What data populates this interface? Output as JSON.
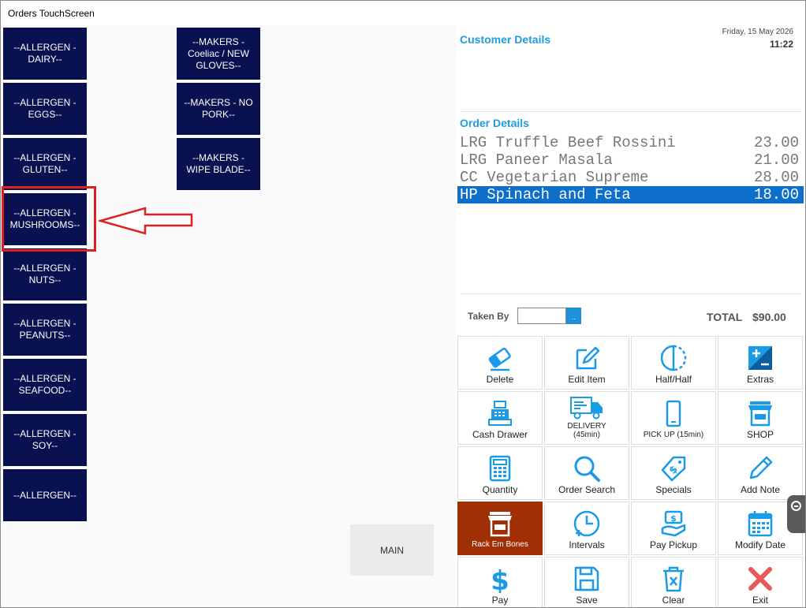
{
  "window": {
    "title": "Orders TouchScreen"
  },
  "categories": {
    "col1": [
      "--ALLERGEN - DAIRY--",
      "--ALLERGEN - EGGS--",
      "--ALLERGEN - GLUTEN--",
      "--ALLERGEN - MUSHROOMS--",
      "--ALLERGEN - NUTS--",
      "--ALLERGEN - PEANUTS--",
      "--ALLERGEN - SEAFOOD--",
      "--ALLERGEN - SOY--",
      "--ALLERGEN--"
    ],
    "col2": [
      "--MAKERS - Coeliac / NEW GLOVES--",
      "--MAKERS - NO PORK--",
      "--MAKERS - WIPE BLADE--"
    ],
    "main_label": "MAIN"
  },
  "header": {
    "date": "Friday, 15 May 2026",
    "time": "11:22"
  },
  "customer": {
    "heading": "Customer Details"
  },
  "order": {
    "heading": "Order Details",
    "items": [
      {
        "name": "LRG Truffle Beef Rossini",
        "price": "23.00",
        "selected": false
      },
      {
        "name": "LRG Paneer Masala",
        "price": "21.00",
        "selected": false
      },
      {
        "name": "CC Vegetarian Supreme",
        "price": "28.00",
        "selected": false
      },
      {
        "name": "HP Spinach and Feta",
        "price": "18.00",
        "selected": true
      }
    ],
    "taken_by_label": "Taken By",
    "taken_by_button": "..",
    "total_label": "TOTAL",
    "total_value": "$90.00"
  },
  "actions": [
    {
      "label": "Delete",
      "icon": "eraser-icon"
    },
    {
      "label": "Edit Item",
      "icon": "edit-icon"
    },
    {
      "label": "Half/Half",
      "icon": "half-circle-icon"
    },
    {
      "label": "Extras",
      "icon": "plus-minus-icon"
    },
    {
      "label": "Cash Drawer",
      "icon": "cash-register-icon"
    },
    {
      "label": "DELIVERY (45min)",
      "icon": "truck-icon"
    },
    {
      "label": "PICK UP (15min)",
      "icon": "phone-icon"
    },
    {
      "label": "SHOP",
      "icon": "shop-icon"
    },
    {
      "label": "Quantity",
      "icon": "calculator-icon"
    },
    {
      "label": "Order Search",
      "icon": "magnifier-icon"
    },
    {
      "label": "Specials",
      "icon": "tag-icon"
    },
    {
      "label": "Add Note",
      "icon": "pencil-icon"
    },
    {
      "label": "Rack Em Bones",
      "icon": "store-icon"
    },
    {
      "label": "Intervals",
      "icon": "clock-icon"
    },
    {
      "label": "Pay Pickup",
      "icon": "money-hand-icon"
    },
    {
      "label": "Modify Date",
      "icon": "calendar-icon"
    },
    {
      "label": "Pay",
      "icon": "dollar-icon"
    },
    {
      "label": "Save",
      "icon": "floppy-icon"
    },
    {
      "label": "Clear",
      "icon": "trash-icon"
    },
    {
      "label": "Exit",
      "icon": "x-icon"
    }
  ],
  "colors": {
    "category_button": "#0a1151",
    "accent_blue": "#1f9be0",
    "selected_row": "#0d6fc9",
    "highlight": "#e02020",
    "brown_button": "#a12f06"
  }
}
